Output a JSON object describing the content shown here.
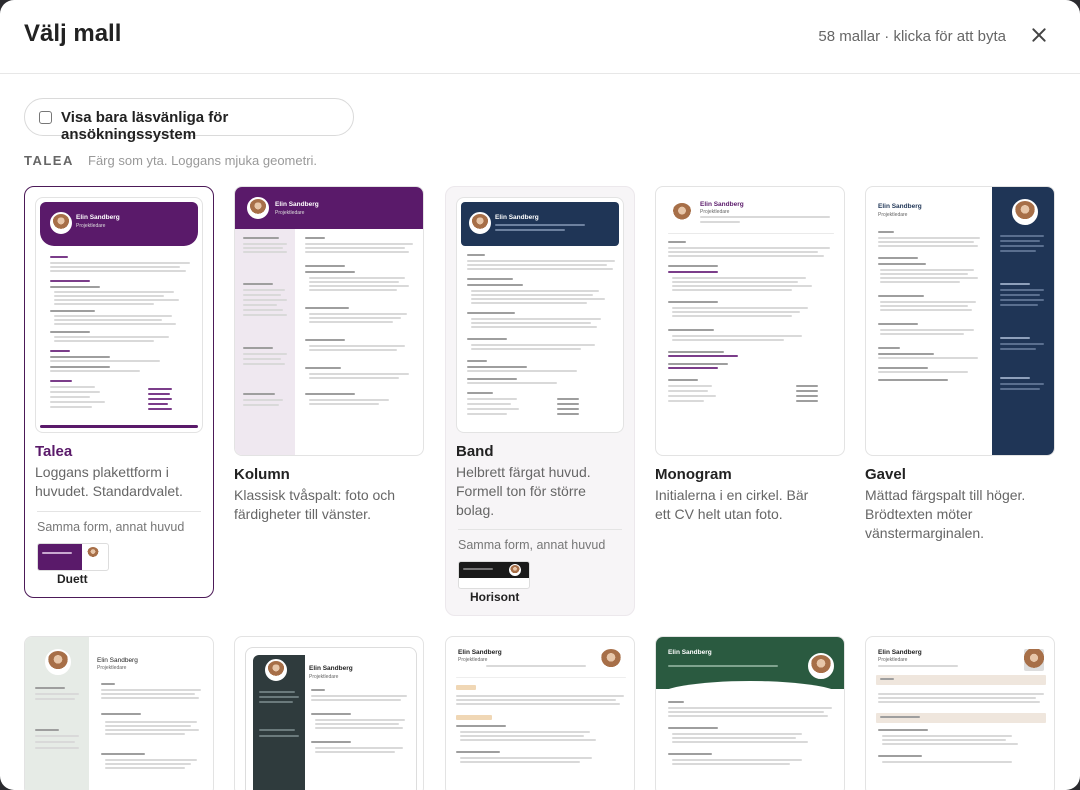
{
  "header": {
    "title": "Välj mall",
    "count": "58 mallar · klicka för att byta"
  },
  "filter": {
    "label": "Visa bara läsvänliga för ansökningssystem",
    "checked": false
  },
  "group": {
    "title": "TALEA",
    "description": "Färg som yta. Loggans mjuka geometri."
  },
  "sample": {
    "name": "Elin Sandberg",
    "role": "Projektledare"
  },
  "variant_label": "Samma form, annat huvud",
  "cards": [
    {
      "name": "Talea",
      "desc": "Loggans plakettform i huvudet. Standardvalet.",
      "selected": true,
      "variant": "Duett"
    },
    {
      "name": "Kolumn",
      "desc": "Klassisk tvåspalt: foto och färdigheter till vänster."
    },
    {
      "name": "Band",
      "desc": "Helbrett färgat huvud. Formell ton för större bolag.",
      "variant": "Horisont"
    },
    {
      "name": "Monogram",
      "desc": "Initialerna i en cirkel. Bär ett CV helt utan foto."
    },
    {
      "name": "Gavel",
      "desc": "Mättad färgspalt till höger. Brödtexten möter vänstermarginalen."
    }
  ],
  "colors": {
    "accent": "#4c1a58",
    "purple": "#5a1a6a",
    "navy": "#1f3556",
    "green": "#2a5a40"
  }
}
